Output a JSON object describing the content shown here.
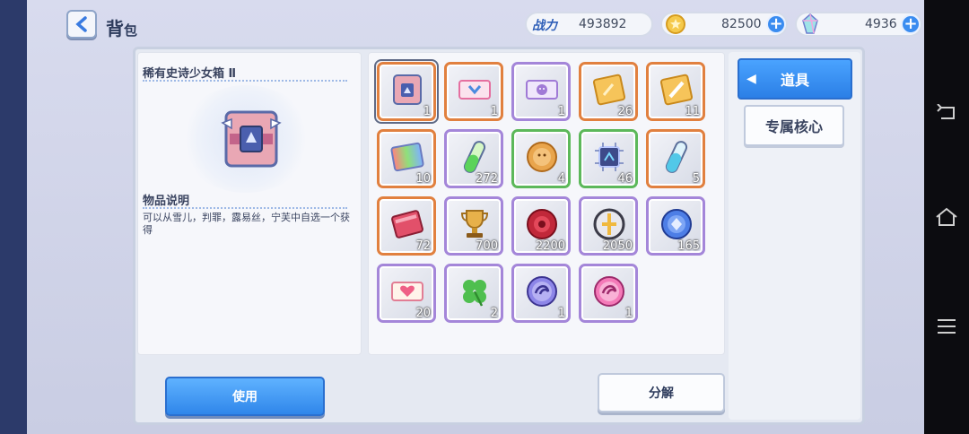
{
  "header": {
    "title_main": "背",
    "title_sub": "包",
    "power_label": "战力",
    "power_value": "493892",
    "gold_value": "82500",
    "gem_value": "4936"
  },
  "detail": {
    "item_name": "稀有史诗少女箱 Ⅱ",
    "desc_heading": "物品说明",
    "desc_text": "可以从雪儿，判罪，露易丝，宁芙中自选一个获得"
  },
  "items": [
    {
      "count": "1",
      "icon": "epic-girl-box-icon",
      "rarity": "orange"
    },
    {
      "count": "1",
      "icon": "pink-ticket-icon",
      "rarity": "orange"
    },
    {
      "count": "1",
      "icon": "smile-ticket-icon",
      "rarity": "purple"
    },
    {
      "count": "26",
      "icon": "gold-card-icon",
      "rarity": "orange"
    },
    {
      "count": "11",
      "icon": "gold-sword-card-icon",
      "rarity": "orange"
    },
    {
      "count": "10",
      "icon": "rainbow-card-icon",
      "rarity": "orange"
    },
    {
      "count": "272",
      "icon": "green-vial-icon",
      "rarity": "purple"
    },
    {
      "count": "4",
      "icon": "cookie-coin-icon",
      "rarity": "green"
    },
    {
      "count": "46",
      "icon": "chip-icon",
      "rarity": "green"
    },
    {
      "count": "5",
      "icon": "blue-vial-icon",
      "rarity": "orange"
    },
    {
      "count": "72",
      "icon": "red-scroll-icon",
      "rarity": "orange"
    },
    {
      "count": "700",
      "icon": "trophy-icon",
      "rarity": "purple"
    },
    {
      "count": "2200",
      "icon": "red-seal-icon",
      "rarity": "purple"
    },
    {
      "count": "2050",
      "icon": "silver-coin-icon",
      "rarity": "purple"
    },
    {
      "count": "165",
      "icon": "blue-coin-icon",
      "rarity": "purple"
    },
    {
      "count": "20",
      "icon": "heart-ticket-icon",
      "rarity": "purple"
    },
    {
      "count": "2",
      "icon": "clover-icon",
      "rarity": "purple"
    },
    {
      "count": "1",
      "icon": "dragon-coin-icon",
      "rarity": "purple"
    },
    {
      "count": "1",
      "icon": "pink-dragon-coin-icon",
      "rarity": "purple"
    }
  ],
  "tabs": {
    "active_label": "道具",
    "other_label": "专属核心"
  },
  "buttons": {
    "use_label": "使用",
    "decompose_label": "分解"
  },
  "colors": {
    "accent": "#2f86ea",
    "rarity_orange": "#e1803f",
    "rarity_purple": "#a486d9",
    "rarity_green": "#5cb85a"
  }
}
